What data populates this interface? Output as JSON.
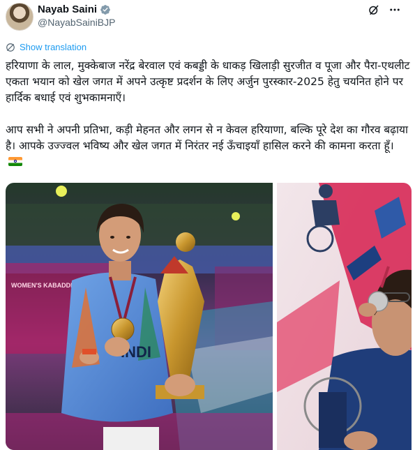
{
  "author": {
    "name": "Nayab Saini",
    "handle": "@NayabSainiBJP"
  },
  "translate_label": "Show translation",
  "tweet": {
    "paragraphs": [
      "हरियाणा के लाल, मुक्केबाज नरेंद्र बेरवाल एवं कबड्डी के धाकड़ खिलाड़ी सुरजीत व पूजा और पैरा-एथलीट एकता भयान को खेल जगत में अपने उत्कृष्ट प्रदर्शन के लिए अर्जुन पुरस्कार-2025 हेतु चयनित होने पर हार्दिक बधाई एवं शुभकामनाएँ।",
      "आप सभी ने अपनी प्रतिभा, कड़ी मेहनत और लगन से न केवल हरियाणा, बल्कि पूरे देश का गौरव बढ़ाया है। आपके उज्ज्वल भविष्य और खेल जगत में निरंतर नई ऊँचाइयाँ हासिल करने की कामना करता हूँ।"
    ]
  },
  "photo1": {
    "banner_text": "WOMEN'S KABADDI WORLD CUP",
    "jersey_text": "INDI"
  },
  "colors": {
    "link": "#1d9bf0",
    "verified": "#829aab",
    "secondary_text": "#536471"
  },
  "icons": [
    "verified-badge-icon",
    "grok-icon",
    "more-icon",
    "translate-icon",
    "india-flag-icon"
  ]
}
